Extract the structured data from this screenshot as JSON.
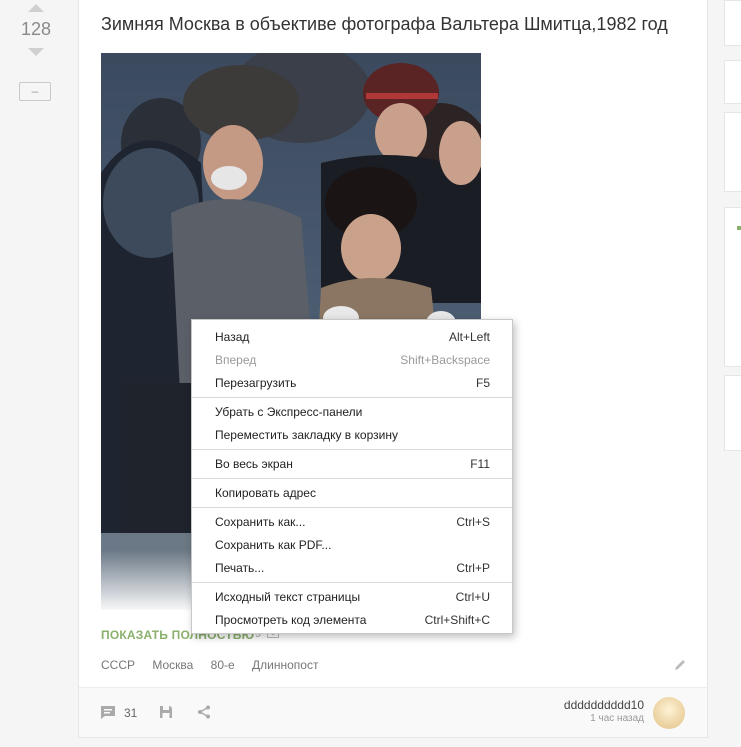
{
  "post": {
    "rating": "128",
    "collapse_label": "–",
    "title": "Зимняя Москва в объективе фотографа Вальтера Шмитца,1982 год",
    "show_more_label": "ПОКАЗАТЬ ПОЛНОСТЬЮ",
    "show_more_count": "9",
    "tags": [
      "СССР",
      "Москва",
      "80-е",
      "Длиннопост"
    ],
    "comments_count": "31",
    "author": {
      "name": "dddddddddd10",
      "time": "1 час назад"
    }
  },
  "context_menu": {
    "groups": [
      [
        {
          "label": "Назад",
          "shortcut": "Alt+Left",
          "disabled": false
        },
        {
          "label": "Вперед",
          "shortcut": "Shift+Backspace",
          "disabled": true
        },
        {
          "label": "Перезагрузить",
          "shortcut": "F5",
          "disabled": false
        }
      ],
      [
        {
          "label": "Убрать с Экспресс-панели",
          "shortcut": "",
          "disabled": false
        },
        {
          "label": "Переместить закладку в корзину",
          "shortcut": "",
          "disabled": false
        }
      ],
      [
        {
          "label": "Во весь экран",
          "shortcut": "F11",
          "disabled": false
        }
      ],
      [
        {
          "label": "Копировать адрес",
          "shortcut": "",
          "disabled": false
        }
      ],
      [
        {
          "label": "Сохранить как...",
          "shortcut": "Ctrl+S",
          "disabled": false
        },
        {
          "label": "Сохранить как PDF...",
          "shortcut": "",
          "disabled": false
        },
        {
          "label": "Печать...",
          "shortcut": "Ctrl+P",
          "disabled": false
        }
      ],
      [
        {
          "label": "Исходный текст страницы",
          "shortcut": "Ctrl+U",
          "disabled": false
        },
        {
          "label": "Просмотреть код элемента",
          "shortcut": "Ctrl+Shift+C",
          "disabled": false
        }
      ]
    ]
  },
  "icons": {
    "upvote": "arrow-up-icon",
    "downvote": "arrow-down-icon",
    "comments": "comment-icon",
    "save": "floppy-disk-icon",
    "share": "share-icon",
    "edit": "pencil-icon",
    "show_more": "expand-icon"
  },
  "colors": {
    "accent_green": "#8ab06c",
    "card_bg": "#ffffff",
    "page_bg": "#f5f5f5"
  }
}
